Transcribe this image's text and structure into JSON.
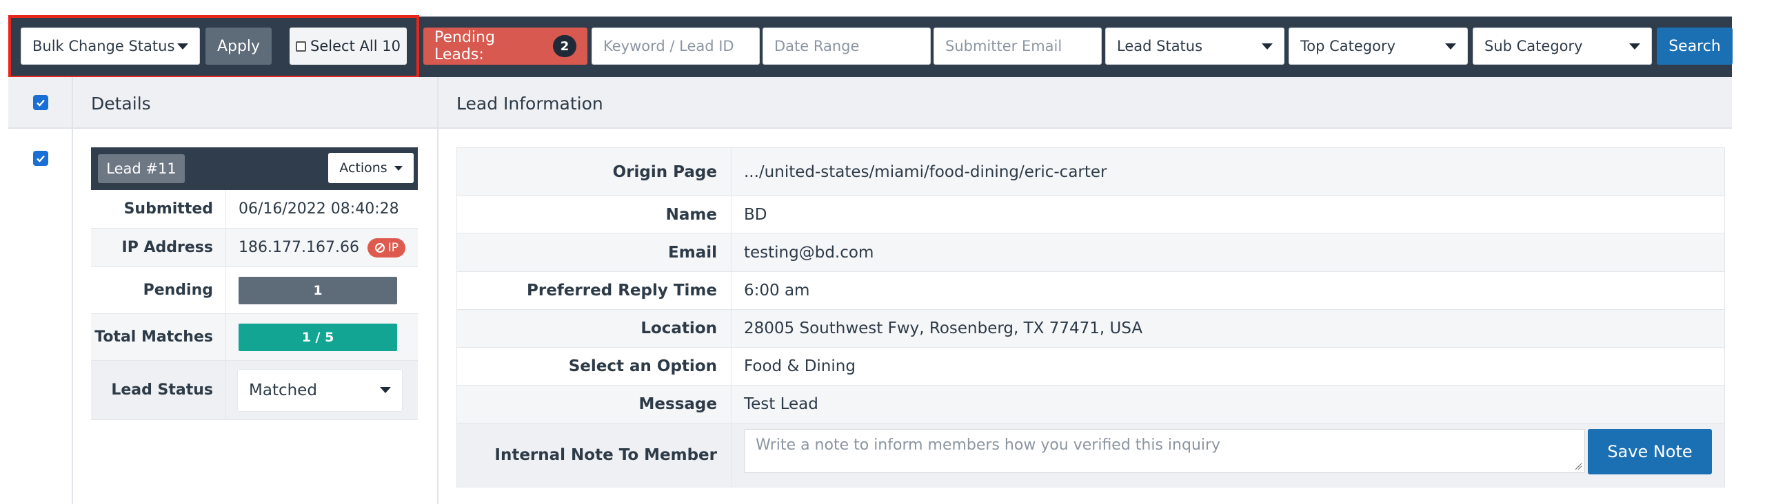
{
  "toolbar": {
    "bulk_status": "Bulk Change Status",
    "apply": "Apply",
    "select_all": "Select All 10",
    "pending_label": "Pending Leads:",
    "pending_count": "2",
    "keyword_placeholder": "Keyword / Lead ID",
    "date_placeholder": "Date Range",
    "email_placeholder": "Submitter Email",
    "lead_status": "Lead Status",
    "top_category": "Top Category",
    "sub_category": "Sub Category",
    "search": "Search"
  },
  "table": {
    "details_header": "Details",
    "info_header": "Lead Information"
  },
  "lead": {
    "badge": "Lead #11",
    "actions": "Actions",
    "submitted_label": "Submitted",
    "submitted": "06/16/2022 08:40:28",
    "ip_label": "IP Address",
    "ip": "186.177.167.66",
    "ip_badge": "IP",
    "pending_label": "Pending",
    "pending": "1",
    "matches_label": "Total Matches",
    "matches": "1 / 5",
    "status_label": "Lead Status",
    "status": "Matched"
  },
  "info": {
    "rows": [
      {
        "label": "Origin Page",
        "value": ".../united-states/miami/food-dining/eric-carter"
      },
      {
        "label": "Name",
        "value": "BD"
      },
      {
        "label": "Email",
        "value": "testing@bd.com"
      },
      {
        "label": "Preferred Reply Time",
        "value": "6:00 am"
      },
      {
        "label": "Location",
        "value": "28005 Southwest Fwy, Rosenberg, TX 77471, USA"
      },
      {
        "label": "Select an Option",
        "value": "Food & Dining"
      },
      {
        "label": "Message",
        "value": "Test Lead"
      }
    ],
    "note_label": "Internal Note To Member",
    "note_placeholder": "Write a note to inform members how you verified this inquiry",
    "save_note": "Save Note"
  },
  "colors": {
    "toolbar_bg": "#2f3d4c",
    "highlight": "#e8271c",
    "pending_leads": "#d8594f",
    "primary_blue": "#1b6fb3",
    "teal": "#12a593",
    "checkbox": "#1a6fd4"
  }
}
